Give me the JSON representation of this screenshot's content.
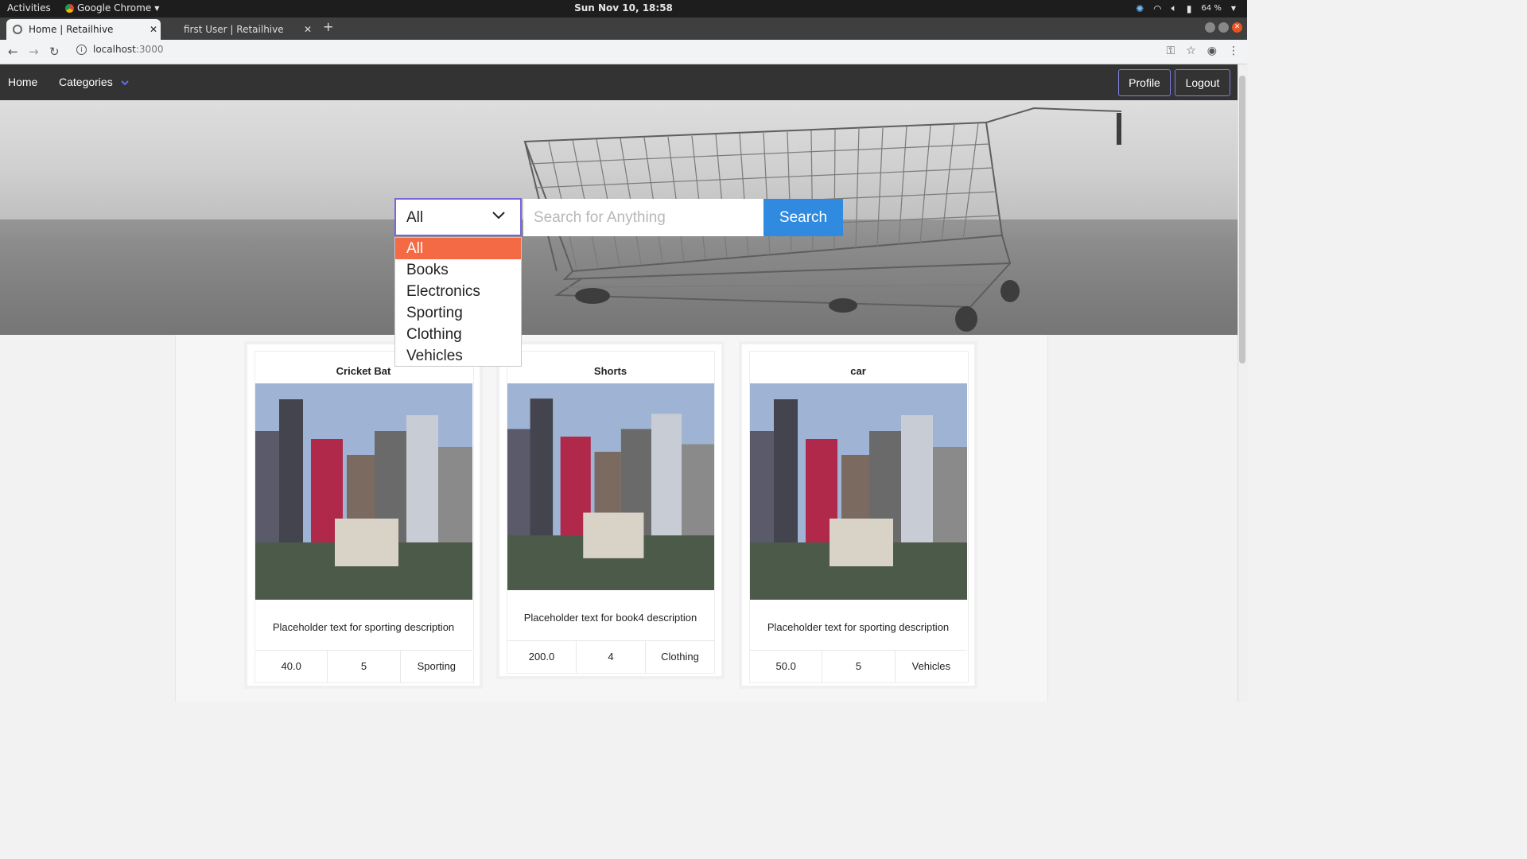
{
  "os": {
    "activities": "Activities",
    "app_name": "Google Chrome",
    "clock": "Sun Nov 10, 18:58",
    "battery": "64 %"
  },
  "browser": {
    "tabs": [
      {
        "title": "Home | Retailhive",
        "active": true
      },
      {
        "title": "first User | Retailhive",
        "active": false
      }
    ],
    "url_host": "localhost",
    "url_port": ":3000"
  },
  "navbar": {
    "home": "Home",
    "categories": "Categories",
    "profile": "Profile",
    "logout": "Logout"
  },
  "search": {
    "category_selected": "All",
    "placeholder": "Search for Anything",
    "button": "Search",
    "options": [
      "All",
      "Books",
      "Electronics",
      "Sporting",
      "Clothing",
      "Vehicles"
    ]
  },
  "products": [
    {
      "name": "Cricket Bat",
      "description": "Placeholder text for sporting description",
      "price": "40.0",
      "quantity": "5",
      "category": "Sporting"
    },
    {
      "name": "Shorts",
      "description": "Placeholder text for book4 description",
      "price": "200.0",
      "quantity": "4",
      "category": "Clothing"
    },
    {
      "name": "car",
      "description": "Placeholder text for sporting description",
      "price": "50.0",
      "quantity": "5",
      "category": "Vehicles"
    }
  ],
  "colors": {
    "navbar_bg": "#333333",
    "search_button": "#2f8ae0",
    "dropdown_selected": "#f46a45",
    "select_border": "#7766dd"
  }
}
